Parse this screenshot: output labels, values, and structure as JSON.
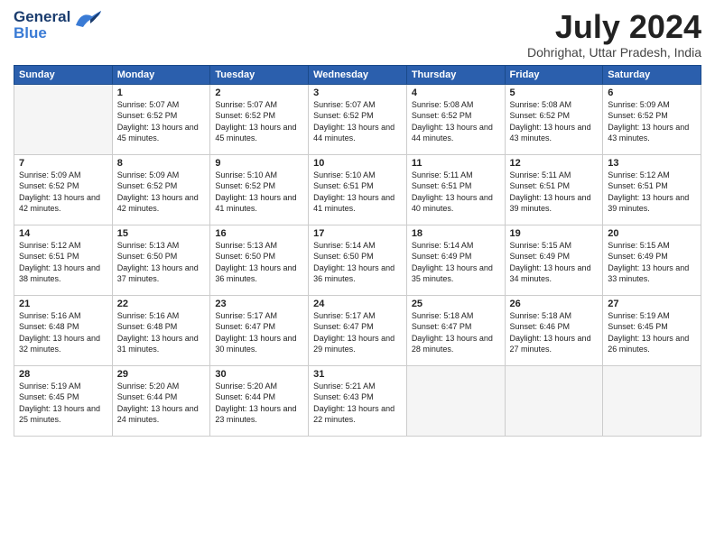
{
  "header": {
    "logo_general": "General",
    "logo_blue": "Blue",
    "month": "July 2024",
    "location": "Dohrighat, Uttar Pradesh, India"
  },
  "days_of_week": [
    "Sunday",
    "Monday",
    "Tuesday",
    "Wednesday",
    "Thursday",
    "Friday",
    "Saturday"
  ],
  "weeks": [
    [
      {
        "day": "",
        "empty": true
      },
      {
        "day": "1",
        "sunrise": "5:07 AM",
        "sunset": "6:52 PM",
        "daylight": "13 hours and 45 minutes."
      },
      {
        "day": "2",
        "sunrise": "5:07 AM",
        "sunset": "6:52 PM",
        "daylight": "13 hours and 45 minutes."
      },
      {
        "day": "3",
        "sunrise": "5:07 AM",
        "sunset": "6:52 PM",
        "daylight": "13 hours and 44 minutes."
      },
      {
        "day": "4",
        "sunrise": "5:08 AM",
        "sunset": "6:52 PM",
        "daylight": "13 hours and 44 minutes."
      },
      {
        "day": "5",
        "sunrise": "5:08 AM",
        "sunset": "6:52 PM",
        "daylight": "13 hours and 43 minutes."
      },
      {
        "day": "6",
        "sunrise": "5:09 AM",
        "sunset": "6:52 PM",
        "daylight": "13 hours and 43 minutes."
      }
    ],
    [
      {
        "day": "7",
        "sunrise": "5:09 AM",
        "sunset": "6:52 PM",
        "daylight": "13 hours and 42 minutes."
      },
      {
        "day": "8",
        "sunrise": "5:09 AM",
        "sunset": "6:52 PM",
        "daylight": "13 hours and 42 minutes."
      },
      {
        "day": "9",
        "sunrise": "5:10 AM",
        "sunset": "6:52 PM",
        "daylight": "13 hours and 41 minutes."
      },
      {
        "day": "10",
        "sunrise": "5:10 AM",
        "sunset": "6:51 PM",
        "daylight": "13 hours and 41 minutes."
      },
      {
        "day": "11",
        "sunrise": "5:11 AM",
        "sunset": "6:51 PM",
        "daylight": "13 hours and 40 minutes."
      },
      {
        "day": "12",
        "sunrise": "5:11 AM",
        "sunset": "6:51 PM",
        "daylight": "13 hours and 39 minutes."
      },
      {
        "day": "13",
        "sunrise": "5:12 AM",
        "sunset": "6:51 PM",
        "daylight": "13 hours and 39 minutes."
      }
    ],
    [
      {
        "day": "14",
        "sunrise": "5:12 AM",
        "sunset": "6:51 PM",
        "daylight": "13 hours and 38 minutes."
      },
      {
        "day": "15",
        "sunrise": "5:13 AM",
        "sunset": "6:50 PM",
        "daylight": "13 hours and 37 minutes."
      },
      {
        "day": "16",
        "sunrise": "5:13 AM",
        "sunset": "6:50 PM",
        "daylight": "13 hours and 36 minutes."
      },
      {
        "day": "17",
        "sunrise": "5:14 AM",
        "sunset": "6:50 PM",
        "daylight": "13 hours and 36 minutes."
      },
      {
        "day": "18",
        "sunrise": "5:14 AM",
        "sunset": "6:49 PM",
        "daylight": "13 hours and 35 minutes."
      },
      {
        "day": "19",
        "sunrise": "5:15 AM",
        "sunset": "6:49 PM",
        "daylight": "13 hours and 34 minutes."
      },
      {
        "day": "20",
        "sunrise": "5:15 AM",
        "sunset": "6:49 PM",
        "daylight": "13 hours and 33 minutes."
      }
    ],
    [
      {
        "day": "21",
        "sunrise": "5:16 AM",
        "sunset": "6:48 PM",
        "daylight": "13 hours and 32 minutes."
      },
      {
        "day": "22",
        "sunrise": "5:16 AM",
        "sunset": "6:48 PM",
        "daylight": "13 hours and 31 minutes."
      },
      {
        "day": "23",
        "sunrise": "5:17 AM",
        "sunset": "6:47 PM",
        "daylight": "13 hours and 30 minutes."
      },
      {
        "day": "24",
        "sunrise": "5:17 AM",
        "sunset": "6:47 PM",
        "daylight": "13 hours and 29 minutes."
      },
      {
        "day": "25",
        "sunrise": "5:18 AM",
        "sunset": "6:47 PM",
        "daylight": "13 hours and 28 minutes."
      },
      {
        "day": "26",
        "sunrise": "5:18 AM",
        "sunset": "6:46 PM",
        "daylight": "13 hours and 27 minutes."
      },
      {
        "day": "27",
        "sunrise": "5:19 AM",
        "sunset": "6:45 PM",
        "daylight": "13 hours and 26 minutes."
      }
    ],
    [
      {
        "day": "28",
        "sunrise": "5:19 AM",
        "sunset": "6:45 PM",
        "daylight": "13 hours and 25 minutes."
      },
      {
        "day": "29",
        "sunrise": "5:20 AM",
        "sunset": "6:44 PM",
        "daylight": "13 hours and 24 minutes."
      },
      {
        "day": "30",
        "sunrise": "5:20 AM",
        "sunset": "6:44 PM",
        "daylight": "13 hours and 23 minutes."
      },
      {
        "day": "31",
        "sunrise": "5:21 AM",
        "sunset": "6:43 PM",
        "daylight": "13 hours and 22 minutes."
      },
      {
        "day": "",
        "empty": true
      },
      {
        "day": "",
        "empty": true
      },
      {
        "day": "",
        "empty": true
      }
    ]
  ]
}
